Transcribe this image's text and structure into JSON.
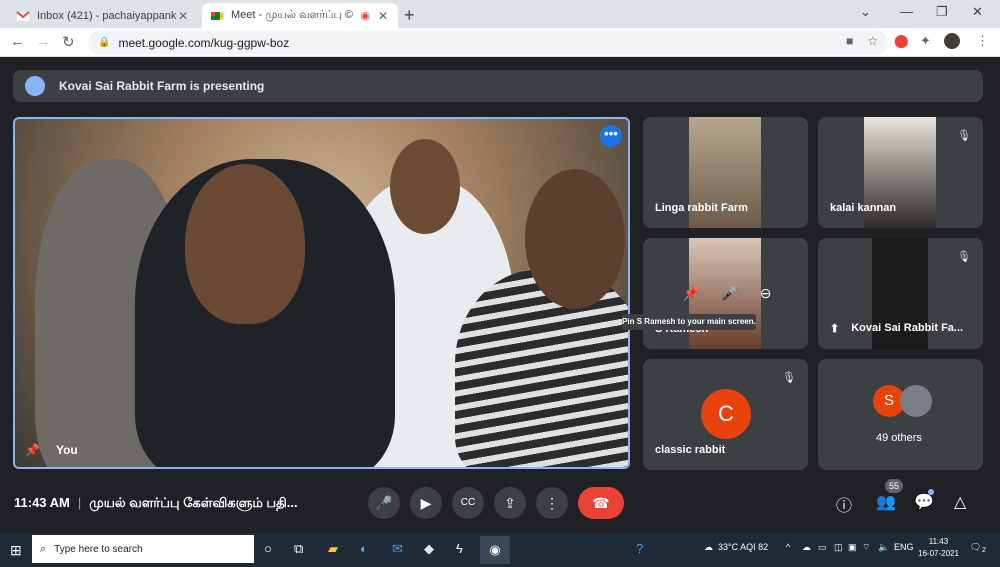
{
  "browser": {
    "tabs": [
      {
        "title": "Inbox (421) - pachaiyappank@gm",
        "icon": "gmail-icon",
        "active": false
      },
      {
        "title": "Meet - முயல் வளர்ப்பு ©",
        "icon": "meet-icon",
        "active": true
      }
    ],
    "new_tab_label": "+",
    "url": "meet.google.com/kug-ggpw-boz"
  },
  "meet": {
    "presenting_banner": "Kovai Sai Rabbit Farm is presenting",
    "self_label": "You",
    "more_options": "•••",
    "participants": [
      {
        "name": "Linga rabbit Farm",
        "muted": false
      },
      {
        "name": "kalai kannan",
        "muted": true
      },
      {
        "name": "S Ramesh",
        "muted": false
      },
      {
        "name": "Kovai Sai Rabbit Fa...",
        "muted": true
      },
      {
        "name": "classic rabbit",
        "muted": true,
        "avatar_letter": "C"
      },
      {
        "name": "49 others",
        "avatar_letter": "S"
      }
    ],
    "tooltip": "Pin S Ramesh to your main screen.",
    "time": "11:43 AM",
    "meeting_title": "முயல் வளர்ப்பு கேள்விகளும் பதி...",
    "people_count": "55",
    "colors": {
      "accent": "#8ab4f8",
      "end_call": "#ea4335",
      "avatar": "#e8430c"
    }
  },
  "taskbar": {
    "search_placeholder": "Type here to search",
    "weather": "33°C  AQI 82",
    "language": "ENG",
    "clock_time": "11:43",
    "clock_date": "16-07-2021",
    "notifications": "2"
  }
}
